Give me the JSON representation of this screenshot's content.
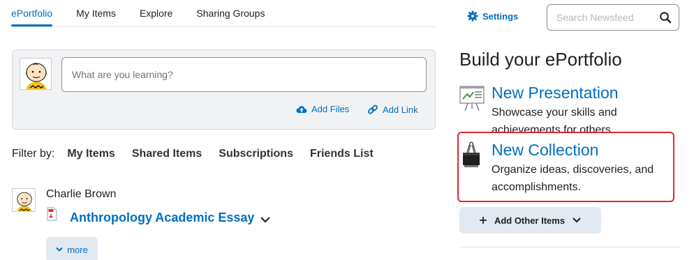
{
  "tabs": [
    {
      "label": "ePortfolio",
      "active": true
    },
    {
      "label": "My Items",
      "active": false
    },
    {
      "label": "Explore",
      "active": false
    },
    {
      "label": "Sharing Groups",
      "active": false
    }
  ],
  "composer": {
    "placeholder": "What are you learning?",
    "add_files": "Add Files",
    "add_link": "Add Link"
  },
  "filter": {
    "label": "Filter by:",
    "items": [
      "My Items",
      "Shared Items",
      "Subscriptions",
      "Friends List"
    ]
  },
  "feed": {
    "author": "Charlie Brown",
    "item_title": "Anthropology Academic Essay",
    "more_label": "more"
  },
  "header_right": {
    "settings_label": "Settings",
    "search_placeholder": "Search Newsfeed"
  },
  "build": {
    "heading": "Build your ePortfolio",
    "items": [
      {
        "title": "New Presentation",
        "description": "Showcase your skills and achievements for others.",
        "icon": "presentation-board-icon"
      },
      {
        "title": "New Collection",
        "description": "Organize ideas, discoveries, and accomplishments.",
        "icon": "binder-clip-icon"
      }
    ],
    "add_other_label": "Add Other Items"
  },
  "colors": {
    "accent": "#006fbf",
    "highlight": "#e0262b",
    "panel_bg": "#f1f2f3",
    "button_bg": "#e3e9f1"
  }
}
